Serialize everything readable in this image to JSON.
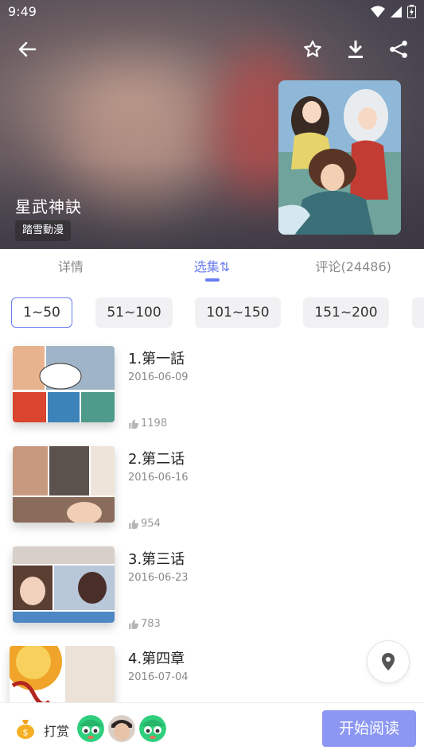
{
  "status": {
    "time": "9:49"
  },
  "icons": {
    "back": "arrow-left-icon",
    "favorite": "star-outline-icon",
    "download": "download-icon",
    "share": "share-icon",
    "location": "location-pin-icon",
    "like": "thumb-up-icon",
    "tip": "money-bag-icon"
  },
  "comic": {
    "title": "星武神訣",
    "author": "踏雪動漫"
  },
  "tabs": [
    {
      "label": "详情"
    },
    {
      "label": "选集⇅"
    },
    {
      "label": "评论(24486)"
    }
  ],
  "ranges": [
    "1~50",
    "51~100",
    "101~150",
    "151~200"
  ],
  "episodes": [
    {
      "title": "1.第一話",
      "date": "2016-06-09",
      "likes": "1198"
    },
    {
      "title": "2.第二话",
      "date": "2016-06-16",
      "likes": "954"
    },
    {
      "title": "3.第三话",
      "date": "2016-06-23",
      "likes": "783"
    },
    {
      "title": "4.第四章",
      "date": "2016-07-04",
      "likes": ""
    }
  ],
  "bottom": {
    "tip_label": "打赏",
    "read_label": "开始阅读"
  },
  "colors": {
    "accent": "#6b7df0",
    "read_button": "#8c97f3"
  }
}
